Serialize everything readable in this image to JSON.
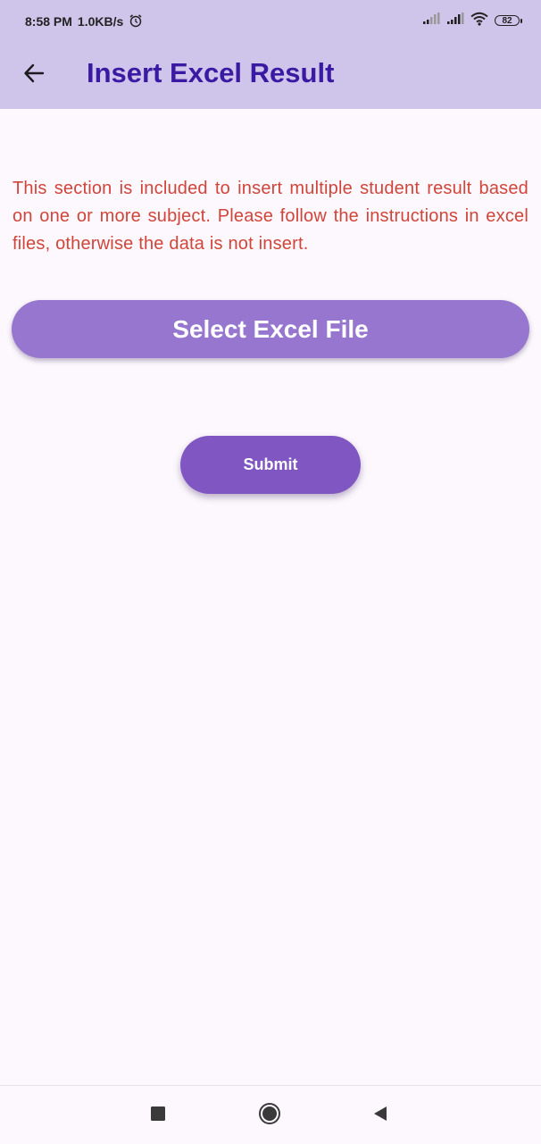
{
  "status_bar": {
    "time": "8:58 PM",
    "net_speed": "1.0KB/s",
    "battery": "82",
    "icons": [
      "alarm-icon",
      "signal-icon",
      "signal-icon",
      "wifi-icon",
      "battery-icon"
    ]
  },
  "app_bar": {
    "title": "Insert Excel Result",
    "back_icon": "arrow-left-icon"
  },
  "main": {
    "description": "This section is included to insert multiple student result based on one or more subject. Please follow the instructions in excel files, otherwise the data is not insert.",
    "select_file_label": "Select Excel File",
    "submit_label": "Submit"
  },
  "nav_bar": {
    "icons": [
      "recent-apps-icon",
      "home-icon",
      "back-icon"
    ]
  },
  "colors": {
    "app_bar_bg": "#cfc4ea",
    "title": "#3a1aa2",
    "description": "#d0453a",
    "select_button": "#9676cf",
    "submit_button": "#7f56c2",
    "page_bg": "#fdf8fd"
  }
}
